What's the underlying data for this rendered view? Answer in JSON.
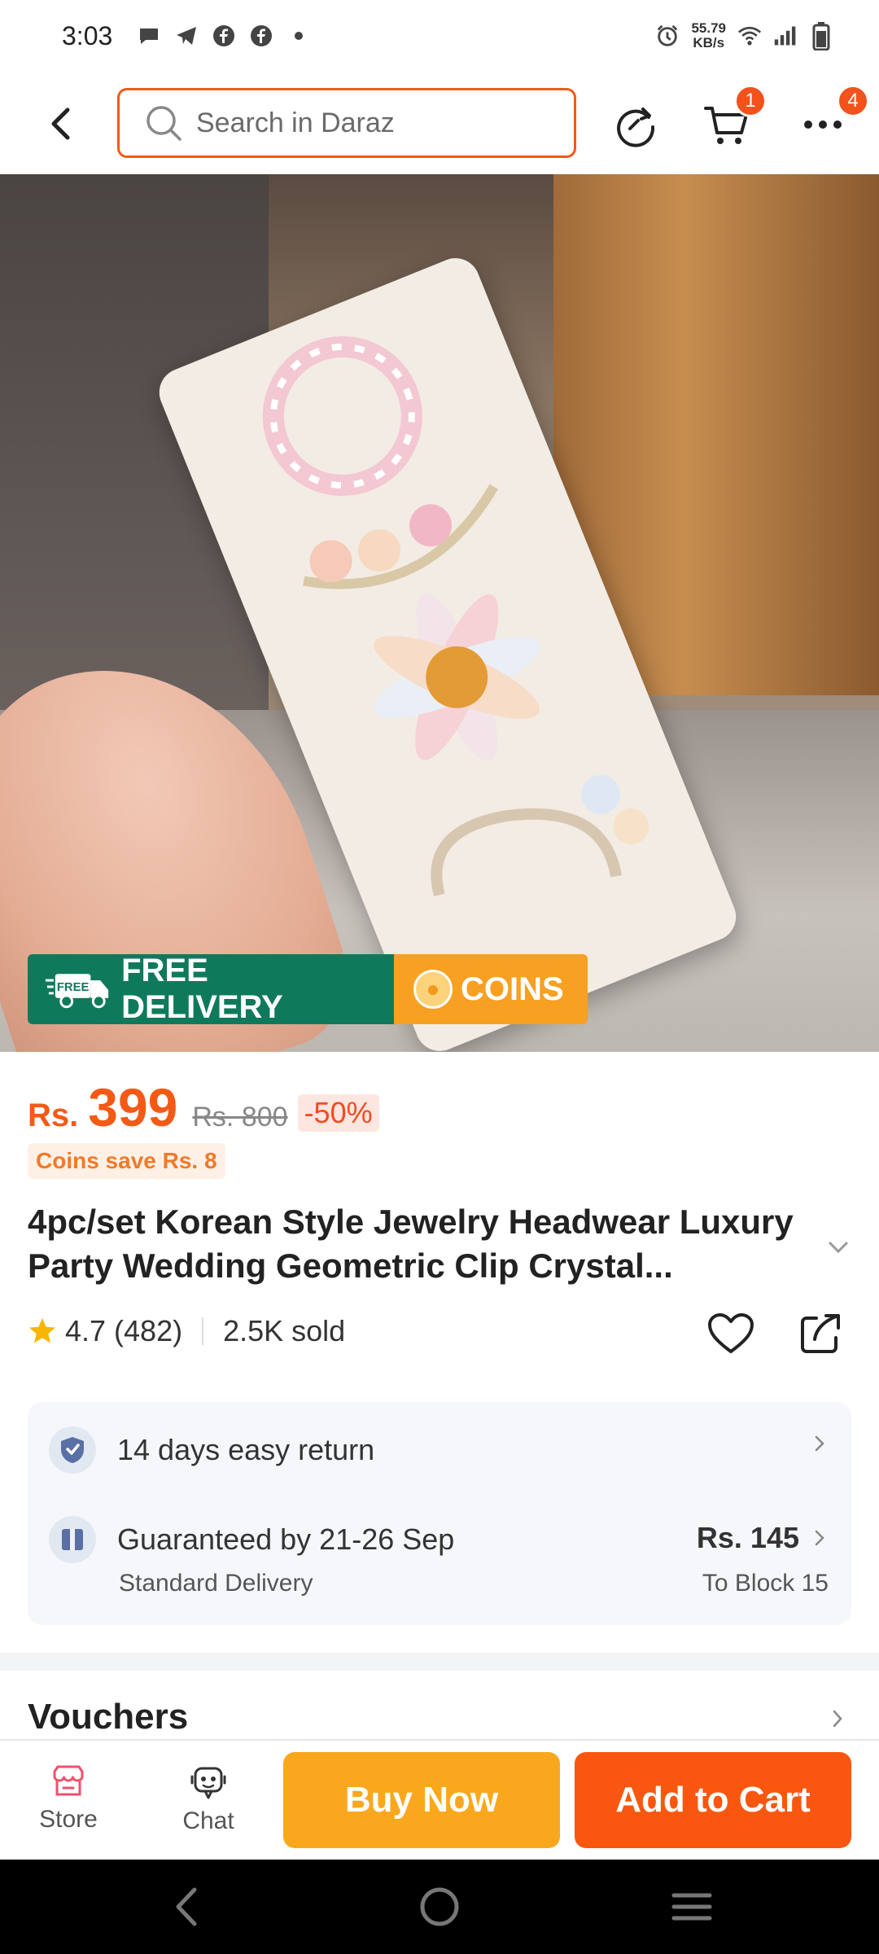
{
  "status_bar": {
    "time": "3:03",
    "netspeed_value": "55.79",
    "netspeed_unit": "KB/s",
    "icons": [
      "message-icon",
      "telegram-icon",
      "facebook-icon",
      "facebook-icon",
      "dot-icon",
      "alarm-icon",
      "wifi-icon",
      "signal-icon",
      "battery-icon"
    ]
  },
  "top_nav": {
    "search_placeholder": "Search in Daraz",
    "cart_badge": "1",
    "more_badge": "4"
  },
  "hero": {
    "promo_free_delivery": "FREE DELIVERY",
    "promo_free_tag": "FREE",
    "promo_coins": "COINS"
  },
  "price": {
    "currency": "Rs.",
    "current": "399",
    "original": "Rs. 800",
    "discount": "-50%",
    "coins_save": "Coins save Rs. 8"
  },
  "product": {
    "title": "4pc/set Korean Style Jewelry Headwear Luxury Party Wedding Geometric Clip Crystal...",
    "rating": "4.7",
    "reviews": "(482)",
    "sold": "2.5K sold"
  },
  "service": {
    "return_text": "14 days easy return",
    "delivery_text": "Guaranteed by 21-26 Sep",
    "delivery_type": "Standard Delivery",
    "delivery_fee": "Rs. 145",
    "delivery_location": "To Block 15"
  },
  "vouchers_label": "Vouchers",
  "action_bar": {
    "store_label": "Store",
    "chat_label": "Chat",
    "buy_now": "Buy Now",
    "add_to_cart": "Add to Cart"
  },
  "colors": {
    "accent_orange": "#f45a16",
    "buy_now_bg": "#f9a81d",
    "add_to_cart_bg": "#f9570f",
    "free_delivery_bg": "#0f7a5b",
    "coins_bg": "#f7a021"
  }
}
